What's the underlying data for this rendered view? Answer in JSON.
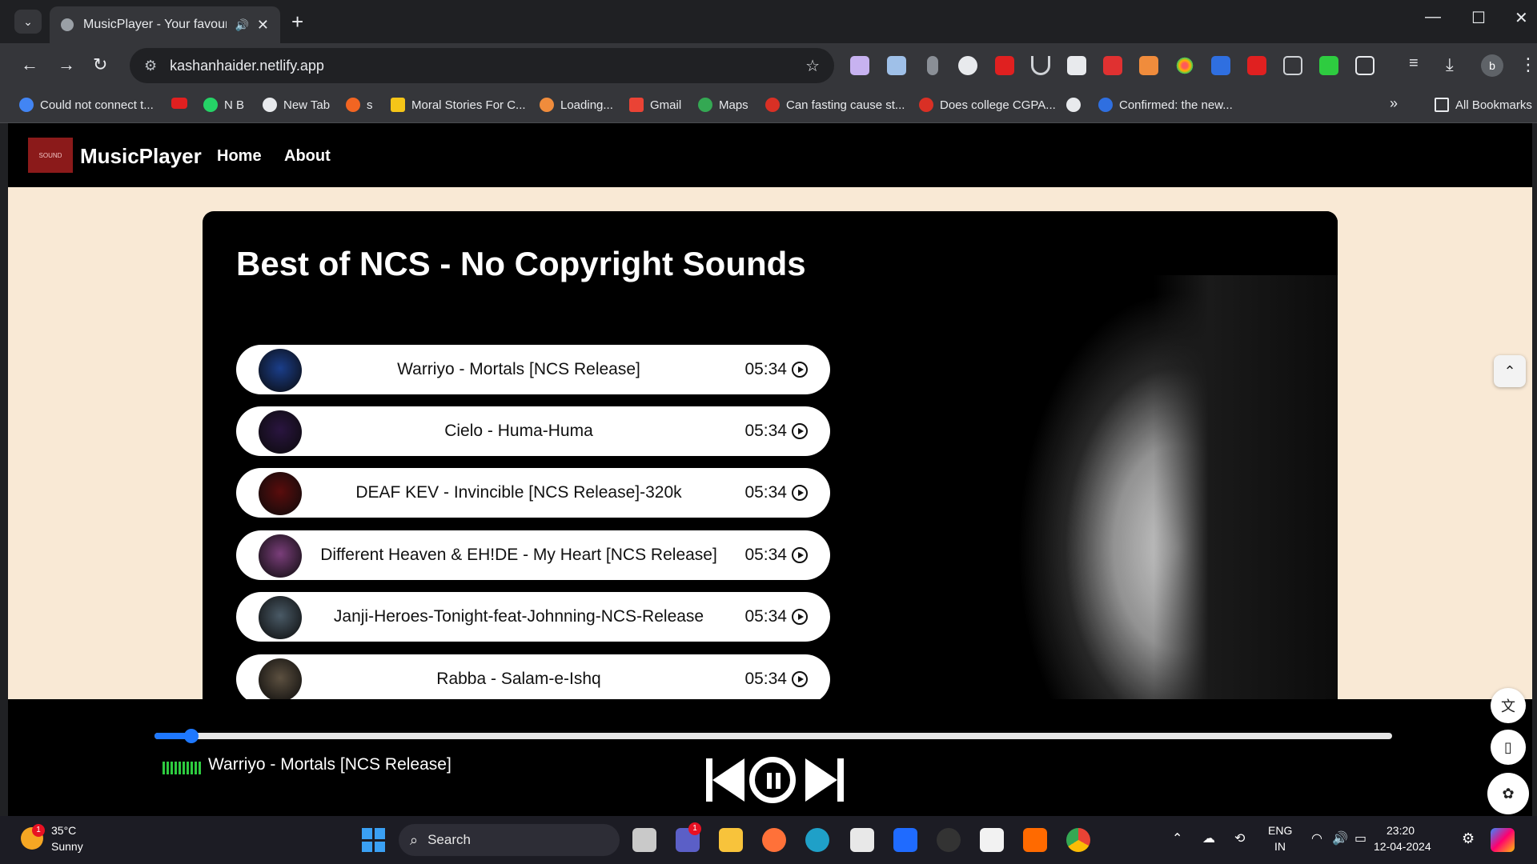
{
  "browser": {
    "tab_title": "MusicPlayer - Your favourite",
    "url": "kashanhaider.netlify.app",
    "bookmarks": [
      {
        "label": "Could not connect t..."
      },
      {
        "label": ""
      },
      {
        "label": "N B"
      },
      {
        "label": "New Tab"
      },
      {
        "label": "s"
      },
      {
        "label": "Moral Stories For C..."
      },
      {
        "label": "Loading..."
      },
      {
        "label": "Gmail"
      },
      {
        "label": "Maps"
      },
      {
        "label": "Can fasting cause st..."
      },
      {
        "label": "Does college CGPA..."
      },
      {
        "label": ""
      },
      {
        "label": "Confirmed: the new..."
      }
    ],
    "all_bookmarks": "All Bookmarks",
    "profile_initial": "b"
  },
  "site": {
    "brand": "MusicPlayer",
    "logo_text": "SOUND",
    "nav": [
      {
        "label": "Home"
      },
      {
        "label": "About"
      }
    ]
  },
  "playlist": {
    "title": "Best of NCS - No Copyright Sounds",
    "songs": [
      {
        "name": "Warriyo - Mortals [NCS Release]",
        "duration": "05:34",
        "cover_color": "#1b3e8a"
      },
      {
        "name": "Cielo - Huma-Huma",
        "duration": "05:34",
        "cover_color": "#2a1540"
      },
      {
        "name": "DEAF KEV - Invincible [NCS Release]-320k",
        "duration": "05:34",
        "cover_color": "#5a0d0d"
      },
      {
        "name": "Different Heaven & EH!DE - My Heart [NCS Release]",
        "duration": "05:34",
        "cover_color": "#7a3e7a"
      },
      {
        "name": "Janji-Heroes-Tonight-feat-Johnning-NCS-Release",
        "duration": "05:34",
        "cover_color": "#4a5a66"
      },
      {
        "name": "Rabba - Salam-e-Ishq",
        "duration": "05:34",
        "cover_color": "#5c5040"
      }
    ]
  },
  "player": {
    "now_playing": "Warriyo - Mortals [NCS Release]",
    "progress_fraction": 0.03,
    "accent": "#1e78ff"
  },
  "taskbar": {
    "temperature": "35°C",
    "condition": "Sunny",
    "weather_badge": "1",
    "search_placeholder": "Search",
    "teams_badge": "1",
    "lang_top": "ENG",
    "lang_bottom": "IN",
    "time": "23:20",
    "date": "12-04-2024"
  }
}
